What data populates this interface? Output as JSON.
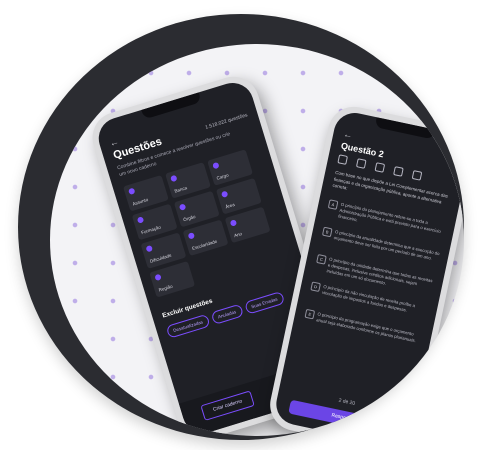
{
  "phone1": {
    "title": "Questões",
    "count": "1.518.022 questões",
    "description": "Combine filtros e comece a resolver questões ou crie um novo caderno",
    "subjects": [
      "Assunto",
      "Banca",
      "Cargo",
      "Formação",
      "Órgão",
      "Área",
      "Dificuldade",
      "Escolaridade",
      "Ano",
      "Região"
    ],
    "exclude_title": "Excluir questões",
    "exclude_chips": [
      "Desatualizadas",
      "Anuladas",
      "Suas Erradas"
    ],
    "create_notebook": "Criar caderno"
  },
  "phone2": {
    "title": "Questão 2",
    "question": "Com base no que dispõe a Lei Complementar acerca das finanças e da organização pública, aponte a alternativa correta:",
    "options": [
      {
        "letter": "A",
        "text": "O princípio do planejamento refere-se a toda a Administração Pública e está previsto para o exercício financeiro."
      },
      {
        "letter": "B",
        "text": "O princípio da anualidade determina que a execução do orçamento deve ser feita por um período de um ano."
      },
      {
        "letter": "C",
        "text": "O princípio da unidade determina que todas as receitas e despesas, inclusive créditos adicionais, sejam incluídas em um só documento."
      },
      {
        "letter": "D",
        "text": "O princípio da não vinculação de receita proíbe a vinculação de impostos a fundos e despesas."
      },
      {
        "letter": "E",
        "text": "O princípio da programação exige que o orçamento anual seja elaborado conforme os planos plurianuais."
      }
    ],
    "pager": "2 de 20",
    "answer_button": "Responder"
  }
}
